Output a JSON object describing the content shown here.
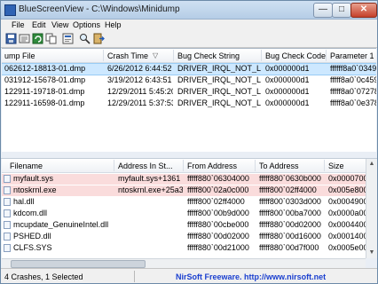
{
  "window": {
    "title": "BlueScreenView  -  C:\\Windows\\Minidump"
  },
  "title_buttons": {
    "minimize": "—",
    "maximize": "□",
    "close": "✕"
  },
  "menu": [
    "File",
    "Edit",
    "View",
    "Options",
    "Help"
  ],
  "toolbar": {
    "icons": [
      "save-icon",
      "open-icon",
      "refresh-icon",
      "copy-icon",
      "properties-icon",
      "search-icon",
      "exit-icon"
    ]
  },
  "dump_list": {
    "columns": [
      "ump File",
      "Crash Time",
      "Bug Check String",
      "Bug Check Code",
      "Parameter 1"
    ],
    "sort_indicator": "▽",
    "rows": [
      {
        "file": "062612-18813-01.dmp",
        "time": "6/26/2012 6:44:52 ...",
        "string": "DRIVER_IRQL_NOT_LESS...",
        "code": "0x000000d1",
        "param": "ffffff8a0`0349d",
        "selected": true
      },
      {
        "file": "031912-15678-01.dmp",
        "time": "3/19/2012 6:43:51 ...",
        "string": "DRIVER_IRQL_NOT_LESS...",
        "code": "0x000000d1",
        "param": "fffff8a0`0c4590",
        "selected": false
      },
      {
        "file": "122911-19718-01.dmp",
        "time": "12/29/2011 5:45:20...",
        "string": "DRIVER_IRQL_NOT_LESS...",
        "code": "0x000000d1",
        "param": "fffff8a0`072780",
        "selected": false
      },
      {
        "file": "122911-16598-01.dmp",
        "time": "12/29/2011 5:37:53...",
        "string": "DRIVER_IRQL_NOT_LESS...",
        "code": "0x000000d1",
        "param": "fffff8a0`0e3780",
        "selected": false
      }
    ]
  },
  "driver_list": {
    "columns": [
      "Filename",
      "Address In St...",
      "From Address",
      "To Address",
      "Size"
    ],
    "rows": [
      {
        "name": "myfault.sys",
        "addr": "myfault.sys+1361",
        "from": "fffff880`06304000",
        "to": "fffff880`0630b000",
        "size": "0x00007000",
        "highlight": true
      },
      {
        "name": "ntoskrnl.exe",
        "addr": "ntoskrnl.exe+25a30",
        "from": "fffff800`02a0c000",
        "to": "fffff800`02ff4000",
        "size": "0x005e8000",
        "highlight": true
      },
      {
        "name": "hal.dll",
        "addr": "",
        "from": "fffff800`02ff4000",
        "to": "fffff800`0303d000",
        "size": "0x00049000",
        "highlight": false
      },
      {
        "name": "kdcom.dll",
        "addr": "",
        "from": "fffff800`00b9d000",
        "to": "fffff800`00ba7000",
        "size": "0x0000a000",
        "highlight": false
      },
      {
        "name": "mcupdate_GenuineIntel.dll",
        "addr": "",
        "from": "fffff880`00cbe000",
        "to": "fffff880`00d02000",
        "size": "0x00044000",
        "highlight": false
      },
      {
        "name": "PSHED.dll",
        "addr": "",
        "from": "fffff880`00d02000",
        "to": "fffff880`00d16000",
        "size": "0x00014000",
        "highlight": false
      },
      {
        "name": "CLFS.SYS",
        "addr": "",
        "from": "fffff880`00d21000",
        "to": "fffff880`00d7f000",
        "size": "0x0005e000",
        "highlight": false
      }
    ]
  },
  "status": {
    "left": "4 Crashes, 1 Selected",
    "link": "NirSoft Freeware.  http://www.nirsoft.net"
  }
}
